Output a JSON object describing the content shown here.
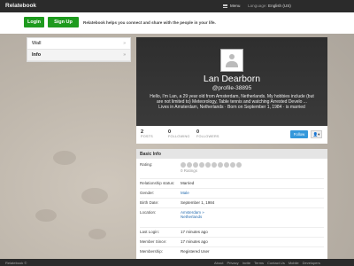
{
  "topbar": {
    "brand": "Relatebook",
    "menu_label": "Menu",
    "language_label": "Language:",
    "language_value": "English (US)"
  },
  "auth": {
    "login_label": "Login",
    "signup_label": "Sign Up",
    "tagline": "Relatebook helps you connect and share with the people in your life."
  },
  "sidebar": {
    "items": [
      {
        "label": "Wall",
        "active": false
      },
      {
        "label": "Info",
        "active": true
      }
    ]
  },
  "profile": {
    "name": "Lan Dearborn",
    "handle": "@profile-38895",
    "bio": "Hello, I'm Lan, a 29 year old from Amsterdam, Netherlands. My hobbies include (but are not limited to) Meteorology, Table tennis and watching Arrested Develo ...",
    "summary": "Lives in Amsterdam, Netherlands · Born on September 1, 1984 · is married",
    "stats": {
      "posts_count": "2",
      "posts_label": "POSTS",
      "following_count": "0",
      "following_label": "FOLLOWING",
      "followers_count": "0",
      "followers_label": "FOLLOWERS"
    },
    "follow_label": "Follow"
  },
  "basic_info": {
    "title": "Basic Info",
    "rating_label": "Rating:",
    "ratings_text": "0 Ratings",
    "rating_value": 0,
    "relationship_label": "Relationship status:",
    "relationship_value": "Married",
    "gender_label": "Gender:",
    "gender_value": "Male",
    "birth_label": "Birth Date:",
    "birth_value": "September 1, 1984",
    "location_label": "Location:",
    "location_city": "Amsterdam »",
    "location_country": "Netherlands",
    "last_login_label": "Last Login:",
    "last_login_value": "17 minutes ago",
    "member_since_label": "Member Since:",
    "member_since_value": "17 minutes ago",
    "membership_label": "Membership:",
    "membership_value": "Registered User"
  },
  "footer": {
    "copyright": "Relatebook ©",
    "links": [
      "About",
      "Privacy",
      "Invite",
      "Terms",
      "Contact Us",
      "Mobile",
      "Developers"
    ]
  },
  "colors": {
    "green": "#1e9a1e",
    "follow_blue": "#3498db",
    "dark_bar": "#2b2b2b",
    "link": "#2a6fb0"
  }
}
